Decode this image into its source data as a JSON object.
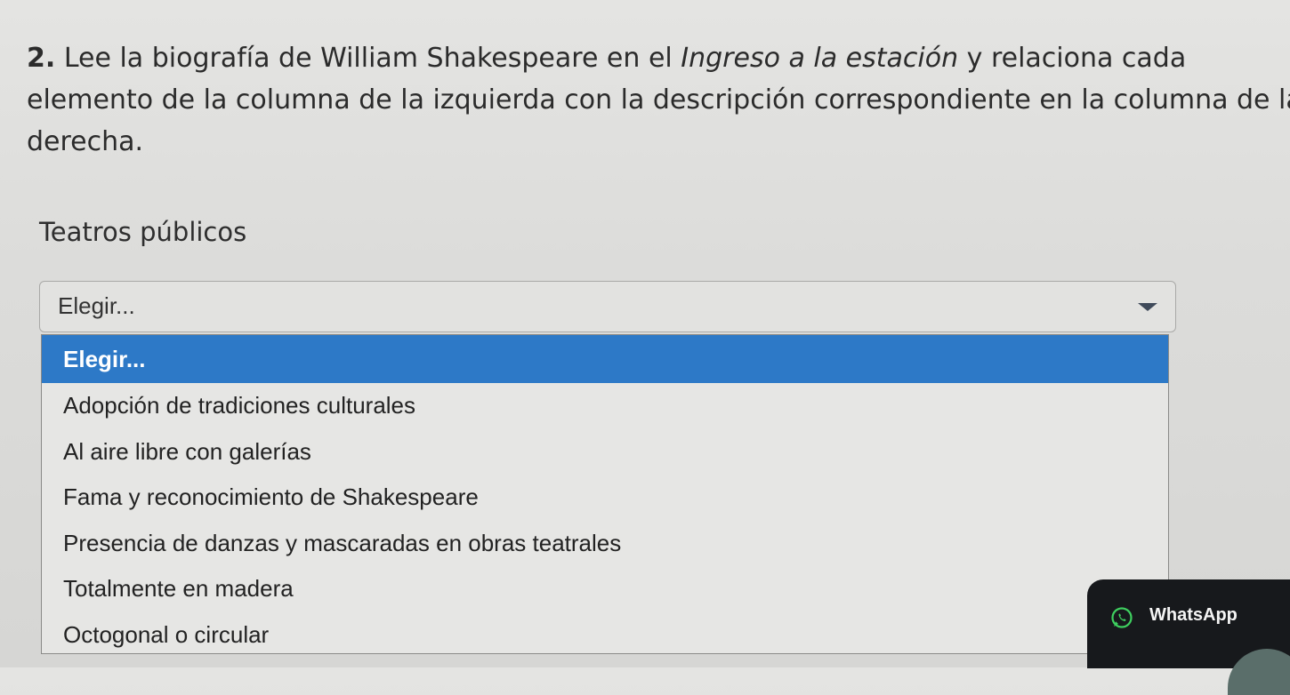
{
  "question": {
    "number": "2.",
    "text_before": "Lee la biografía de William Shakespeare en el",
    "emphasis": "Ingreso a la estación",
    "text_after": "y relaciona cada elemento de la columna de la izquierda con la descripción correspondiente en la columna de la derecha."
  },
  "field": {
    "label": "Teatros públicos",
    "selected_value": "Elegir..."
  },
  "dropdown": {
    "options": [
      {
        "label": "Elegir...",
        "selected": true
      },
      {
        "label": "Adopción de tradiciones culturales",
        "selected": false
      },
      {
        "label": "Al aire libre con galerías",
        "selected": false
      },
      {
        "label": "Fama y reconocimiento de Shakespeare",
        "selected": false
      },
      {
        "label": "Presencia de danzas y mascaradas en obras teatrales",
        "selected": false
      },
      {
        "label": "Totalmente en madera",
        "selected": false
      },
      {
        "label": "Octogonal o circular",
        "selected": false
      }
    ]
  },
  "whatsapp": {
    "label": "WhatsApp",
    "icon": "whatsapp-icon"
  },
  "colors": {
    "highlight": "#2d79c7",
    "whatsapp_bg": "#17191c"
  }
}
